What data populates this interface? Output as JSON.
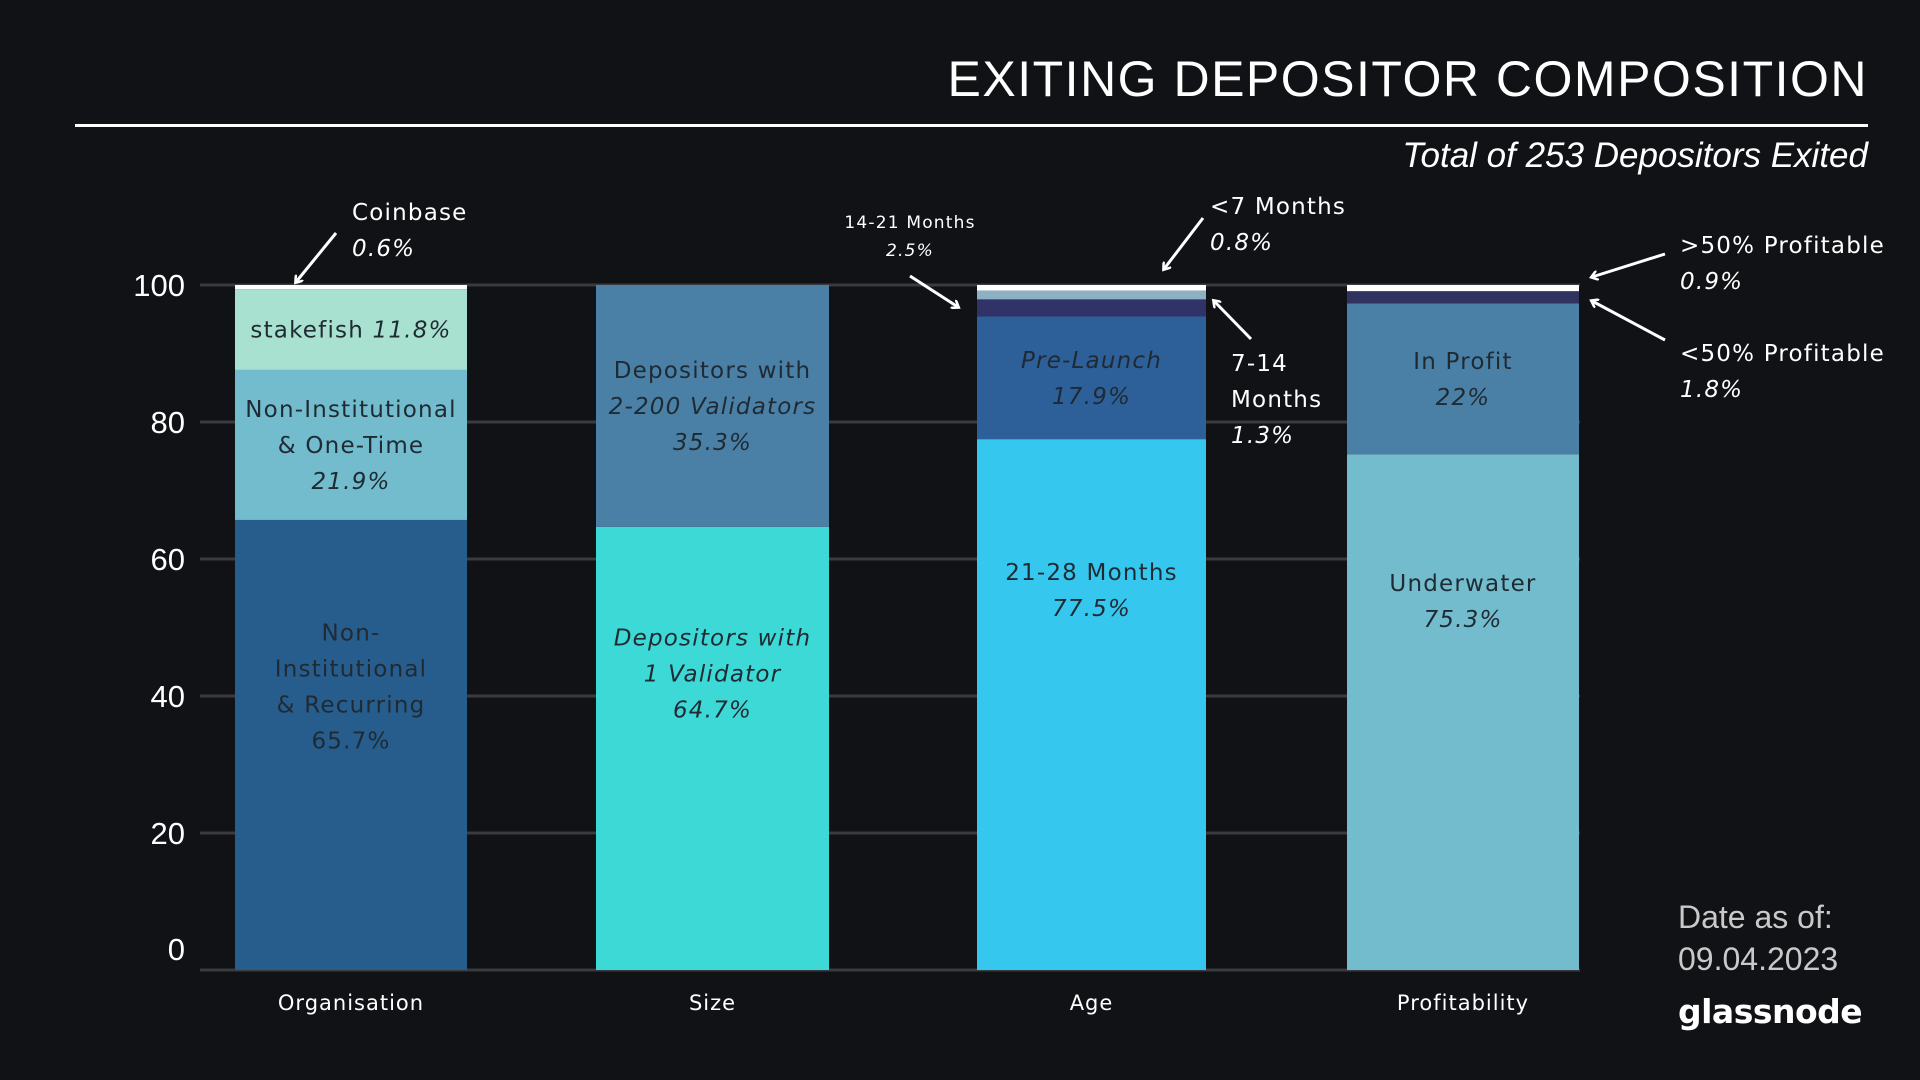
{
  "header": {
    "title": "EXITING DEPOSITOR COMPOSITION",
    "subtitle": "Total of 253 Depositors Exited"
  },
  "footer": {
    "date_label": "Date as of:",
    "date_value": "09.04.2023",
    "brand": "glassnode"
  },
  "chart_data": {
    "type": "bar",
    "stacked": true,
    "title": "EXITING DEPOSITOR COMPOSITION",
    "subtitle": "Total of 253 Depositors Exited",
    "xlabel": "",
    "ylabel": "",
    "ylim": [
      0,
      100
    ],
    "yticks": [
      0,
      20,
      40,
      60,
      80,
      100
    ],
    "grid": true,
    "categories": [
      "Organisation",
      "Size",
      "Age",
      "Profitability"
    ],
    "bars": [
      {
        "category": "Organisation",
        "segments": [
          {
            "name": "Non-Institutional & Recurring",
            "value": 65.7,
            "color": "#265d8d",
            "label_lines": [
              "Non-",
              "Institutional",
              "& Recurring"
            ],
            "value_label": "65.7%",
            "italic_value": false
          },
          {
            "name": "Non-Institutional & One-Time",
            "value": 21.9,
            "color": "#73bccd",
            "label_lines": [
              "Non-Institutional",
              "& One-Time"
            ],
            "value_label": "21.9%",
            "italic_value": true
          },
          {
            "name": "stakefish",
            "value": 11.8,
            "color": "#a8e1cf",
            "label_lines": [
              "stakefish"
            ],
            "value_label": "11.8%",
            "inline": true
          },
          {
            "name": "Coinbase",
            "value": 0.6,
            "color": "#ffffff",
            "annotation": {
              "label": "Coinbase",
              "value_label": "0.6%"
            }
          }
        ]
      },
      {
        "category": "Size",
        "segments": [
          {
            "name": "Depositors with 1 Validator",
            "value": 64.7,
            "color": "#3dd9d6",
            "label_lines": [
              "Depositors with",
              "1 Validator"
            ],
            "value_label": "64.7%",
            "italic_all": true
          },
          {
            "name": "Depositors with 2-200 Validators",
            "value": 35.3,
            "color": "#4a80a6",
            "label_lines": [
              "Depositors with",
              "2-200 Validators"
            ],
            "value_label": "35.3%",
            "italic_from": 1
          }
        ]
      },
      {
        "category": "Age",
        "segments": [
          {
            "name": "21-28 Months",
            "value": 77.5,
            "color": "#36c7ee",
            "label_lines": [
              "21-28 Months"
            ],
            "value_label": "77.5%"
          },
          {
            "name": "Pre-Launch",
            "value": 17.9,
            "color": "#2d5f99",
            "label_lines": [
              "Pre-Launch"
            ],
            "value_label": "17.9%",
            "italic_all": true
          },
          {
            "name": "14-21 Months",
            "value": 2.5,
            "color": "#303367",
            "annotation": {
              "label": "14-21 Months",
              "value_label": "2.5%"
            }
          },
          {
            "name": "7-14 Months",
            "value": 1.3,
            "color": "#8eb0c3",
            "annotation": {
              "label": "7-14 Months",
              "value_label": "1.3%"
            }
          },
          {
            "name": "<7 Months",
            "value": 0.8,
            "color": "#ffffff",
            "annotation": {
              "label": "<7 Months",
              "value_label": "0.8%"
            }
          }
        ]
      },
      {
        "category": "Profitability",
        "segments": [
          {
            "name": "Underwater",
            "value": 75.3,
            "color": "#73bccd",
            "label_lines": [
              "Underwater"
            ],
            "value_label": "75.3%"
          },
          {
            "name": "In Profit",
            "value": 22.0,
            "color": "#4a80a6",
            "label_lines": [
              "In Profit"
            ],
            "value_label": "22%"
          },
          {
            "name": "<50% Profitable",
            "value": 1.8,
            "color": "#303260",
            "annotation": {
              "label": "<50% Profitable",
              "value_label": "1.8%"
            }
          },
          {
            "name": ">50% Profitable",
            "value": 0.9,
            "color": "#ffffff",
            "annotation": {
              "label": ">50% Profitable",
              "value_label": "0.9%"
            }
          }
        ]
      }
    ]
  }
}
